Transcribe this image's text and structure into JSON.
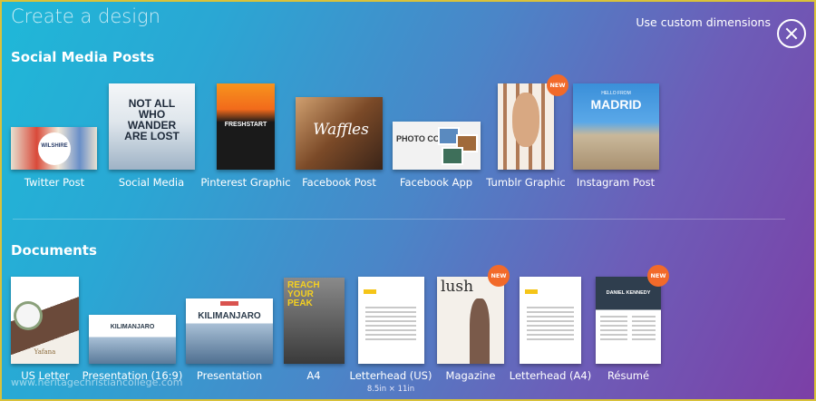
{
  "header": {
    "title": "Create a design",
    "custom_link": "Use custom dimensions"
  },
  "sections": {
    "social": "Social Media Posts",
    "documents": "Documents"
  },
  "social_items": [
    "Twitter Post",
    "Social Media",
    "Pinterest Graphic",
    "Facebook Post",
    "Facebook App",
    "Tumblr Graphic",
    "Instagram Post"
  ],
  "document_items": [
    "US Letter",
    "Presentation (16:9)",
    "Presentation",
    "A4",
    "Letterhead (US)",
    "Magazine",
    "Letterhead (A4)",
    "Résumé"
  ],
  "letterhead_us_size": "8.5in × 11in",
  "badge_text": "NEW",
  "watermark": "www.heritagechristiancollege.com",
  "thumb_text": {
    "twitter": "WILSHIRE",
    "social_media": "NOT ALL WHO WANDER ARE LOST",
    "pinterest": "FRESHSTART",
    "facebook_post": "Waffles",
    "facebook_app": "PHOTO COMP",
    "instagram_small": "HELLO FROM",
    "instagram": "MADRID",
    "us_letter": "Yafana",
    "presentation_169": "KILIMANJARO",
    "presentation": "KILIMANJARO",
    "a4": "REACH YOUR PEAK",
    "magazine": "lush",
    "resume": "DANIEL KENNEDY"
  },
  "colors": {
    "badge": "#f26a2a",
    "gradient_start": "#1fb8d8",
    "gradient_end": "#7c3fa6"
  }
}
